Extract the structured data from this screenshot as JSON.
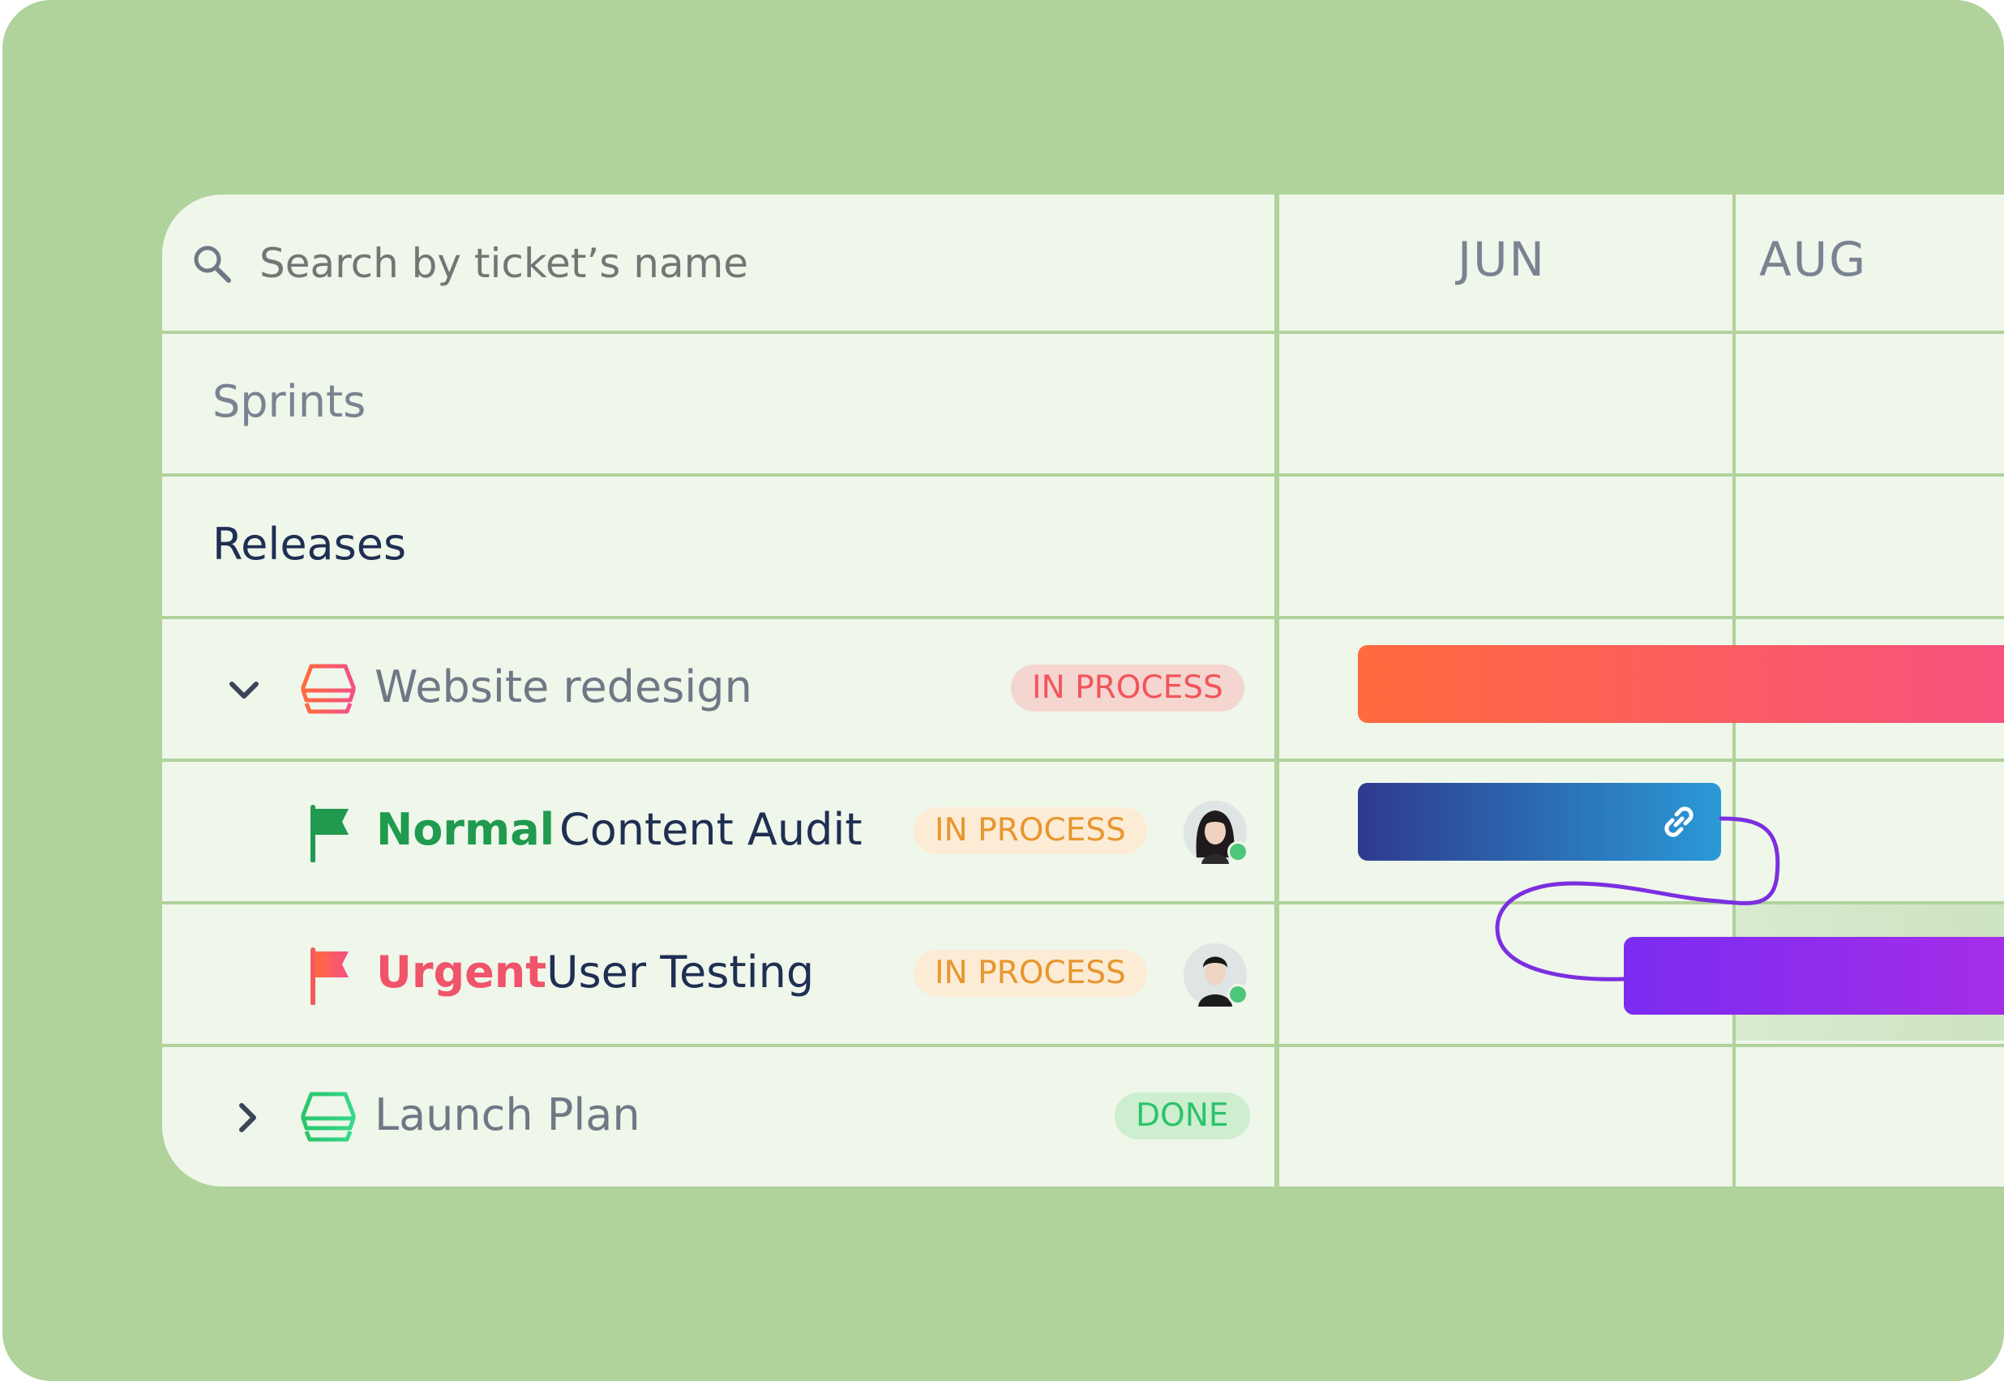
{
  "search": {
    "placeholder": "Search by ticket’s name",
    "icon": "search-icon"
  },
  "timeline": {
    "months": [
      "JUN",
      "AUG"
    ]
  },
  "sections": {
    "sprints": "Sprints",
    "releases": "Releases"
  },
  "rows": [
    {
      "type": "group",
      "expanded": true,
      "icon": "layers-icon",
      "title": "Website redesign",
      "status": "IN PROCESS",
      "status_color": "#f2545b"
    },
    {
      "type": "task",
      "priority": "Normal",
      "priority_color": "#1f9a4e",
      "title": "Content Audit",
      "status": "IN PROCESS",
      "status_color": "#e8962e",
      "avatar": "avatar-woman"
    },
    {
      "type": "task",
      "priority": "Urgent",
      "priority_color": "#f0546a",
      "title": "User Testing",
      "status": "IN PROCESS",
      "status_color": "#e8962e",
      "avatar": "avatar-man"
    },
    {
      "type": "group",
      "expanded": false,
      "icon": "layers-icon",
      "title": "Launch Plan",
      "status": "DONE",
      "status_color": "#2bc36b"
    }
  ],
  "colors": {
    "background": "#b0d29b",
    "panel": "#eff6ea",
    "bar_redesign": [
      "#ff6a3d",
      "#f54f86"
    ],
    "bar_audit": [
      "#2e3a8f",
      "#2a9ad6"
    ],
    "bar_testing": [
      "#7a2cf0",
      "#b12ee6"
    ],
    "connector": "#7b2fe0"
  }
}
